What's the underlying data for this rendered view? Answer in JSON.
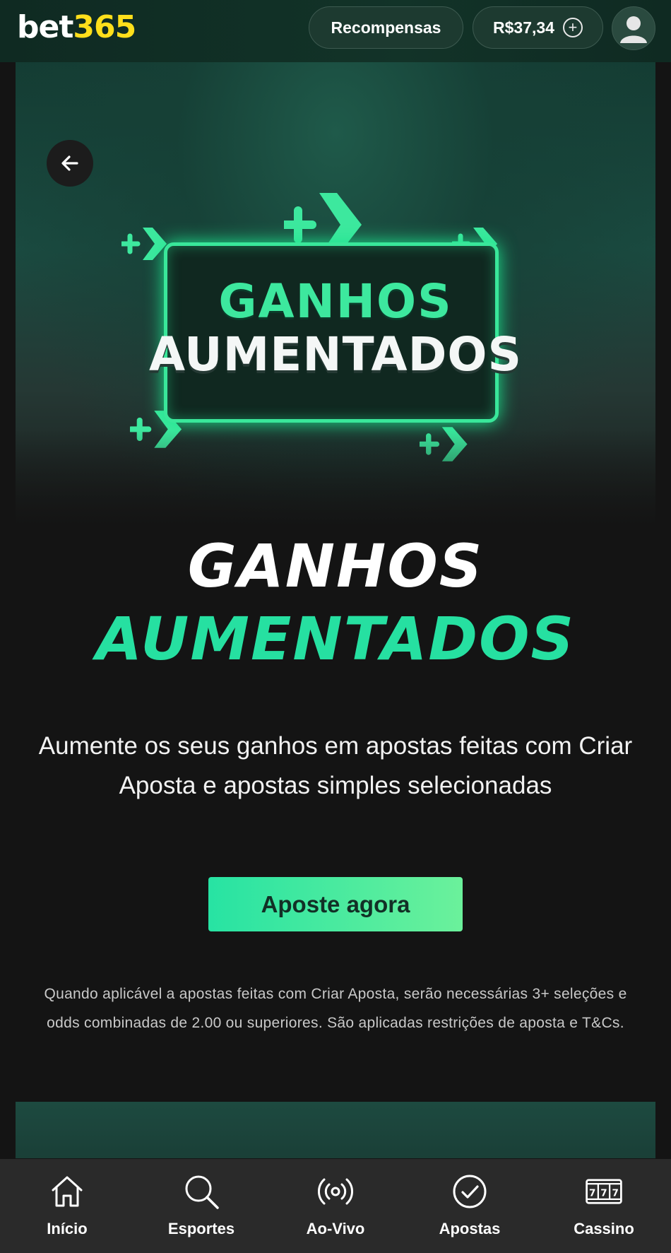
{
  "header": {
    "logo_bet": "bet",
    "logo_num": "365",
    "rewards_label": "Recompensas",
    "balance": "R$37,34"
  },
  "banner": {
    "line1": "GANHOS",
    "line2": "AUMENTADOS"
  },
  "headline": {
    "line1": "GANHOS",
    "line2": "AUMENTADOS"
  },
  "subtitle": "Aumente os seus ganhos em apostas feitas com Criar Aposta e apostas simples selecionadas",
  "cta_label": "Aposte agora",
  "terms": "Quando aplicável a apostas feitas com Criar Aposta, serão necessárias 3+ seleções e odds combinadas de 2.00 ou superiores. São aplicadas restrições de aposta e T&Cs.",
  "nav": {
    "items": [
      {
        "label": "Início",
        "icon": "home-icon"
      },
      {
        "label": "Esportes",
        "icon": "search-icon"
      },
      {
        "label": "Ao-Vivo",
        "icon": "live-broadcast-icon"
      },
      {
        "label": "Apostas",
        "icon": "check-circle-icon"
      },
      {
        "label": "Cassino",
        "icon": "slot-machine-icon"
      }
    ]
  },
  "colors": {
    "accent_green": "#26e0a1",
    "logo_yellow": "#ffdf1b",
    "background": "#141414",
    "header_bg": "#123328"
  }
}
